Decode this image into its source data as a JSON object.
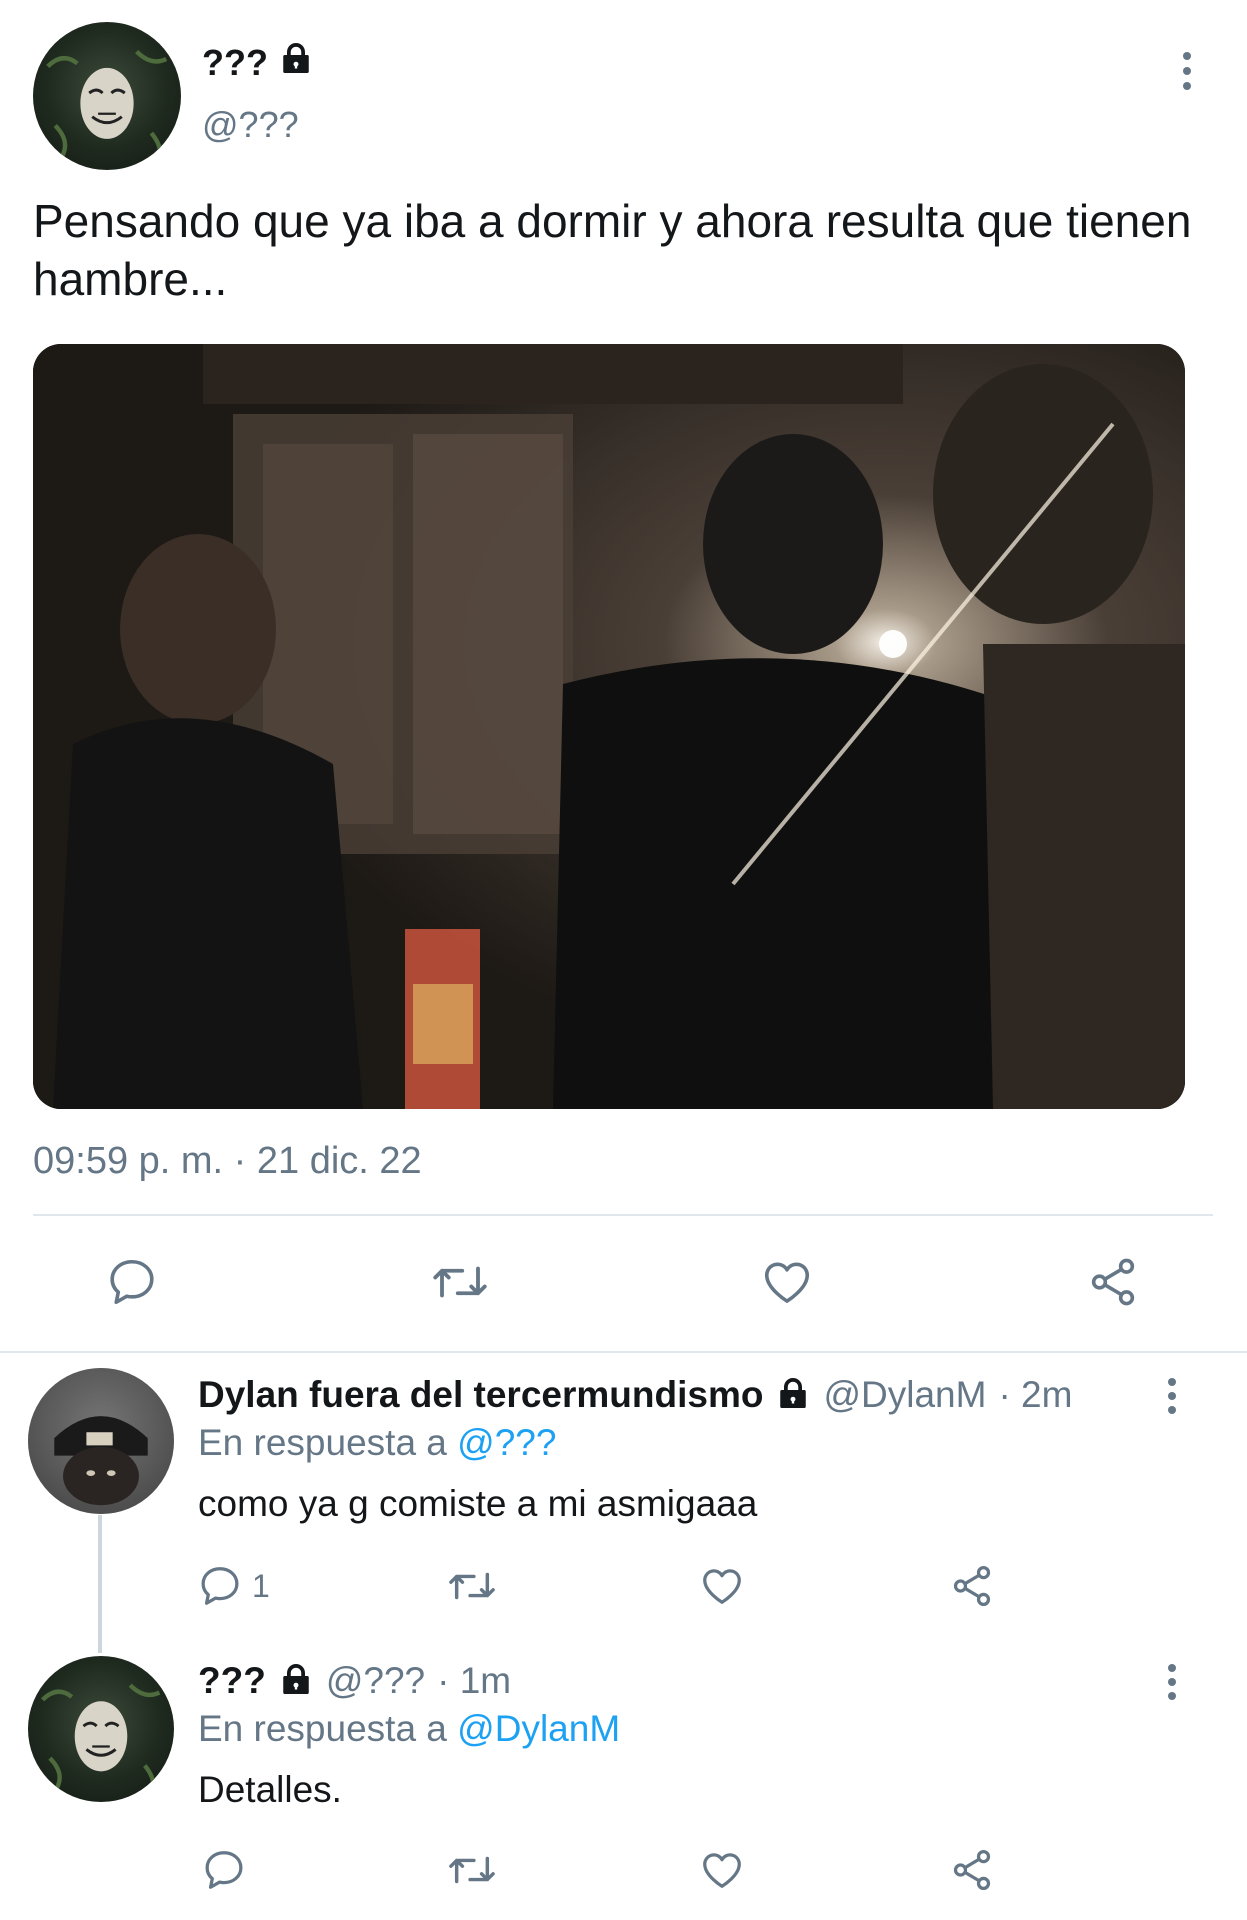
{
  "tweet": {
    "author_name": "???",
    "author_handle": "@???",
    "text": "Pensando que ya iba a dormir y ahora resulta que tienen hambre...",
    "timestamp": "09:59 p. m. · 21 dic. 22",
    "media_description": "photo",
    "actions": [
      "reply-icon",
      "retweet-icon",
      "like-icon",
      "share-icon"
    ]
  },
  "replies": [
    {
      "author_name": "Dylan fuera del tercermundismo",
      "author_handle": "@DylanM",
      "time": "· 2m",
      "in_reply_prefix": "En respuesta a",
      "in_reply_to": "@???",
      "text": "como ya g comiste a mi asmigaaa",
      "reply_count": "1"
    },
    {
      "author_name": "???",
      "author_handle": "@???",
      "time": "· 1m",
      "in_reply_prefix": "En respuesta a",
      "in_reply_to": "@DylanM",
      "text": "Detalles.",
      "reply_count": ""
    }
  ],
  "colors": {
    "text": "#14171a",
    "muted": "#657786",
    "link": "#1da1f2",
    "divider": "#e1e8ed"
  }
}
